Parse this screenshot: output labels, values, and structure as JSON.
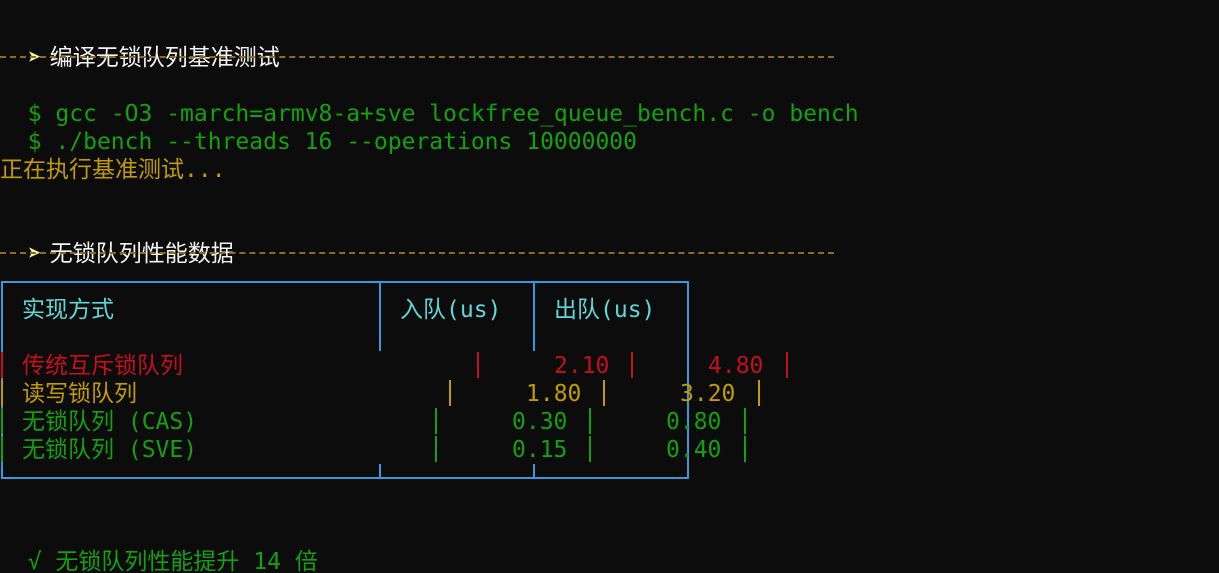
{
  "sections": {
    "compile_title": "编译无锁队列基准测试",
    "perf_title": "无锁队列性能数据"
  },
  "commands": [
    "gcc -O3 -march=armv8-a+sve lockfree_queue_bench.c -o bench",
    "./bench --threads 16 --operations 10000000"
  ],
  "prompt_symbol": "$",
  "arrow_symbol": "➤",
  "status": "正在执行基准测试...",
  "table": {
    "headers": [
      "实现方式",
      "入队(us)",
      "出队(us)"
    ],
    "rows": [
      {
        "name": "传统互斥锁队列",
        "enqueue": "2.10",
        "dequeue": "4.80",
        "color": "#c50f1f"
      },
      {
        "name": "读写锁队列",
        "enqueue": "1.80",
        "dequeue": "3.20",
        "color": "#c19c00"
      },
      {
        "name": "无锁队列 (CAS)",
        "enqueue": "0.30",
        "dequeue": "0.80",
        "color": "#13a10e"
      },
      {
        "name": "无锁队列 (SVE)",
        "enqueue": "0.15",
        "dequeue": "0.40",
        "color": "#13a10e"
      }
    ]
  },
  "summary": {
    "check": "√",
    "text": "无锁队列性能提升 14 倍"
  }
}
